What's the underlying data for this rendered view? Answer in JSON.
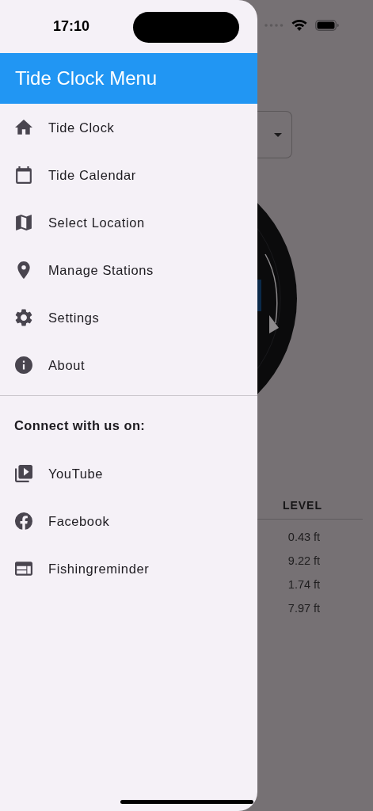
{
  "status_bar": {
    "time": "17:10"
  },
  "drawer": {
    "title": "Tide Clock Menu",
    "items": [
      {
        "label": "Tide Clock"
      },
      {
        "label": "Tide Calendar"
      },
      {
        "label": "Select Location"
      },
      {
        "label": "Manage Stations"
      },
      {
        "label": "Settings"
      },
      {
        "label": "About"
      }
    ],
    "section_heading": "Connect with us on:",
    "social_items": [
      {
        "label": "YouTube"
      },
      {
        "label": "Facebook"
      },
      {
        "label": "Fishingreminder"
      }
    ]
  },
  "background": {
    "table": {
      "column_header": "LEVEL",
      "values": [
        "0.43 ft",
        "9.22 ft",
        "1.74 ft",
        "7.97 ft"
      ]
    }
  }
}
